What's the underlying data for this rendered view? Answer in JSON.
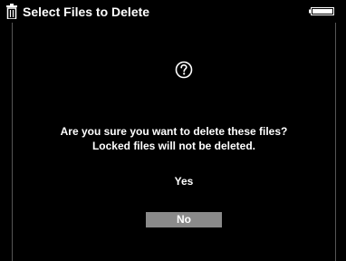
{
  "header": {
    "title": "Select Files to Delete",
    "left_icon": "trash-icon",
    "right_icon": "battery-icon"
  },
  "dialog": {
    "icon": "question-icon",
    "message_line_1": "Are you sure you want to delete these files?",
    "message_line_2": "Locked files will not be deleted.",
    "options": [
      {
        "label": "Yes",
        "selected": false
      },
      {
        "label": "No",
        "selected": true
      }
    ]
  },
  "colors": {
    "background": "#000000",
    "text": "#ffffff",
    "selection_highlight": "#8a8a8a"
  }
}
